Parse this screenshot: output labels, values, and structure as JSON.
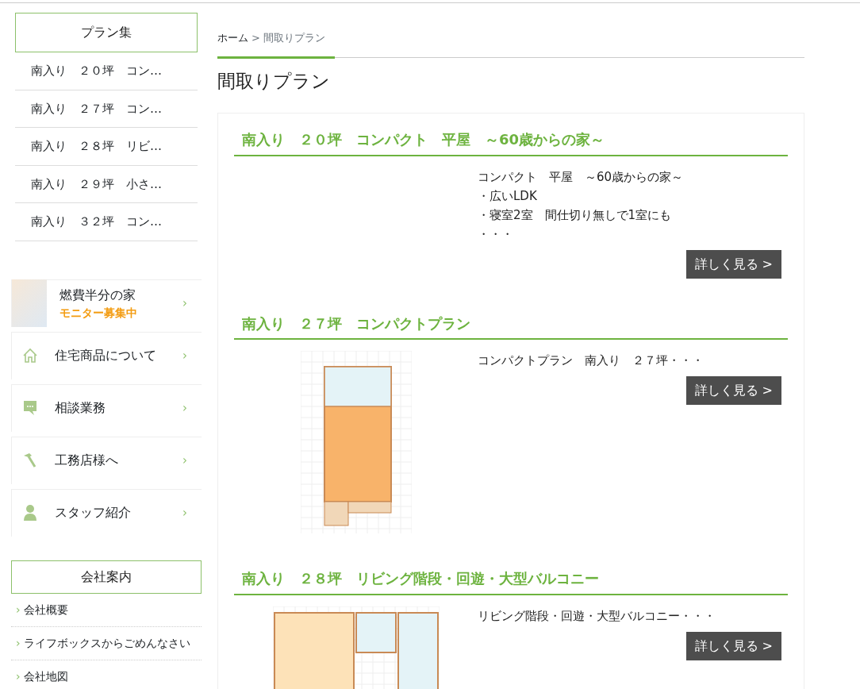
{
  "sidebar": {
    "plan_heading": "プラン集",
    "plan_items": [
      "南入り　２０坪　コン…",
      "南入り　２７坪　コン…",
      "南入り　２８坪　リビ…",
      "南入り　２９坪　小さ…",
      "南入り　３２坪　コン…"
    ],
    "banners": [
      {
        "kind": "photo",
        "title": "燃費半分の家",
        "subtitle": "モニター募集中",
        "arrow": "›"
      },
      {
        "kind": "house",
        "title": "住宅商品について",
        "arrow": "›"
      },
      {
        "kind": "chat",
        "title": "相談業務",
        "arrow": "›"
      },
      {
        "kind": "hammer",
        "title": "工務店様へ",
        "arrow": "›"
      },
      {
        "kind": "person",
        "title": "スタッフ紹介",
        "arrow": "›"
      }
    ],
    "company_heading": "会社案内",
    "company_links": [
      "会社概要",
      "ライフボックスからごめんなさい",
      "会社地図"
    ]
  },
  "breadcrumb": {
    "home": "ホーム",
    "separator": ">",
    "current": "間取りプラン"
  },
  "page_title": "間取りプラン",
  "plans": [
    {
      "title": "南入り　２０坪　コンパクト　平屋　～60歳からの家～",
      "image": false,
      "description": [
        "コンパクト　平屋　～60歳からの家～",
        "・広いLDK",
        "・寝室2室　間仕切り無しで1室にも",
        "・・・"
      ],
      "button": "詳しく見る >"
    },
    {
      "title": "南入り　２７坪　コンパクトプラン",
      "image": true,
      "description": [
        "コンパクトプラン　南入り　２７坪・・・"
      ],
      "button": "詳しく見る >"
    },
    {
      "title": "南入り　２８坪　リビング階段・回遊・大型バルコニー",
      "image": true,
      "description": [
        "リビング階段・回遊・大型バルコニー・・・"
      ],
      "button": "詳しく見る >"
    }
  ]
}
